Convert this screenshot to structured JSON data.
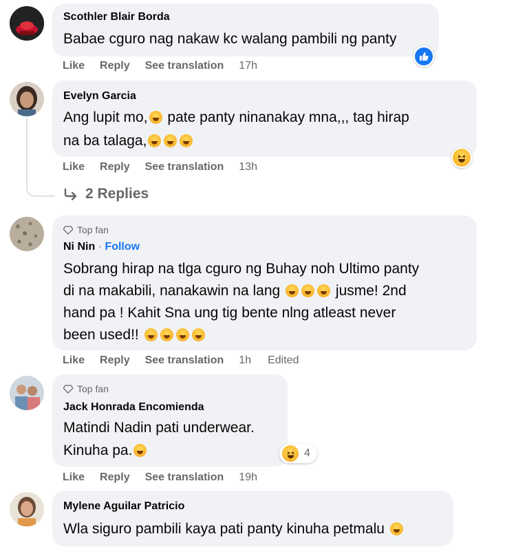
{
  "actions": {
    "like": "Like",
    "reply": "Reply",
    "translate": "See translation"
  },
  "comments": [
    {
      "author": "Scothler Blair Borda",
      "lines": [
        "Babae cguro nag nakaw kc walang pambili ng panty"
      ],
      "time": "17h",
      "reaction": "like"
    },
    {
      "author": "Evelyn Garcia",
      "lines": [
        "Ang lupit mo,",
        "pate panty ninanakay mna,,, tag hirap",
        "na ba talaga,"
      ],
      "time": "13h",
      "reaction": "haha"
    },
    {
      "badge": "Top fan",
      "author": "Ni Nin",
      "follow": "Follow",
      "separator": " · ",
      "lines": [
        "Sobrang hirap na tlga cguro ng Buhay noh Ultimo panty",
        "di na makabili, nanakawin na lang",
        "jusme! 2nd",
        "hand pa ! Kahit Sna ung tig bente nlng atleast never",
        "been used!!"
      ],
      "time": "1h",
      "edited": "Edited"
    },
    {
      "badge": "Top fan",
      "author": "Jack Honrada Encomienda",
      "lines": [
        "Matindi Nadin pati underwear.",
        "Kinuha pa."
      ],
      "time": "19h",
      "reaction": "haha",
      "reaction_count": "4"
    },
    {
      "author": "Mylene Aguilar Patricio",
      "lines": [
        "Wla siguro pambili kaya pati panty kinuha petmalu"
      ]
    }
  ],
  "replies_label": "2 Replies",
  "colors": {
    "bubble": "#f0f2f5",
    "meta": "#65676b",
    "link": "#1877f2",
    "like": "#1877f2"
  }
}
